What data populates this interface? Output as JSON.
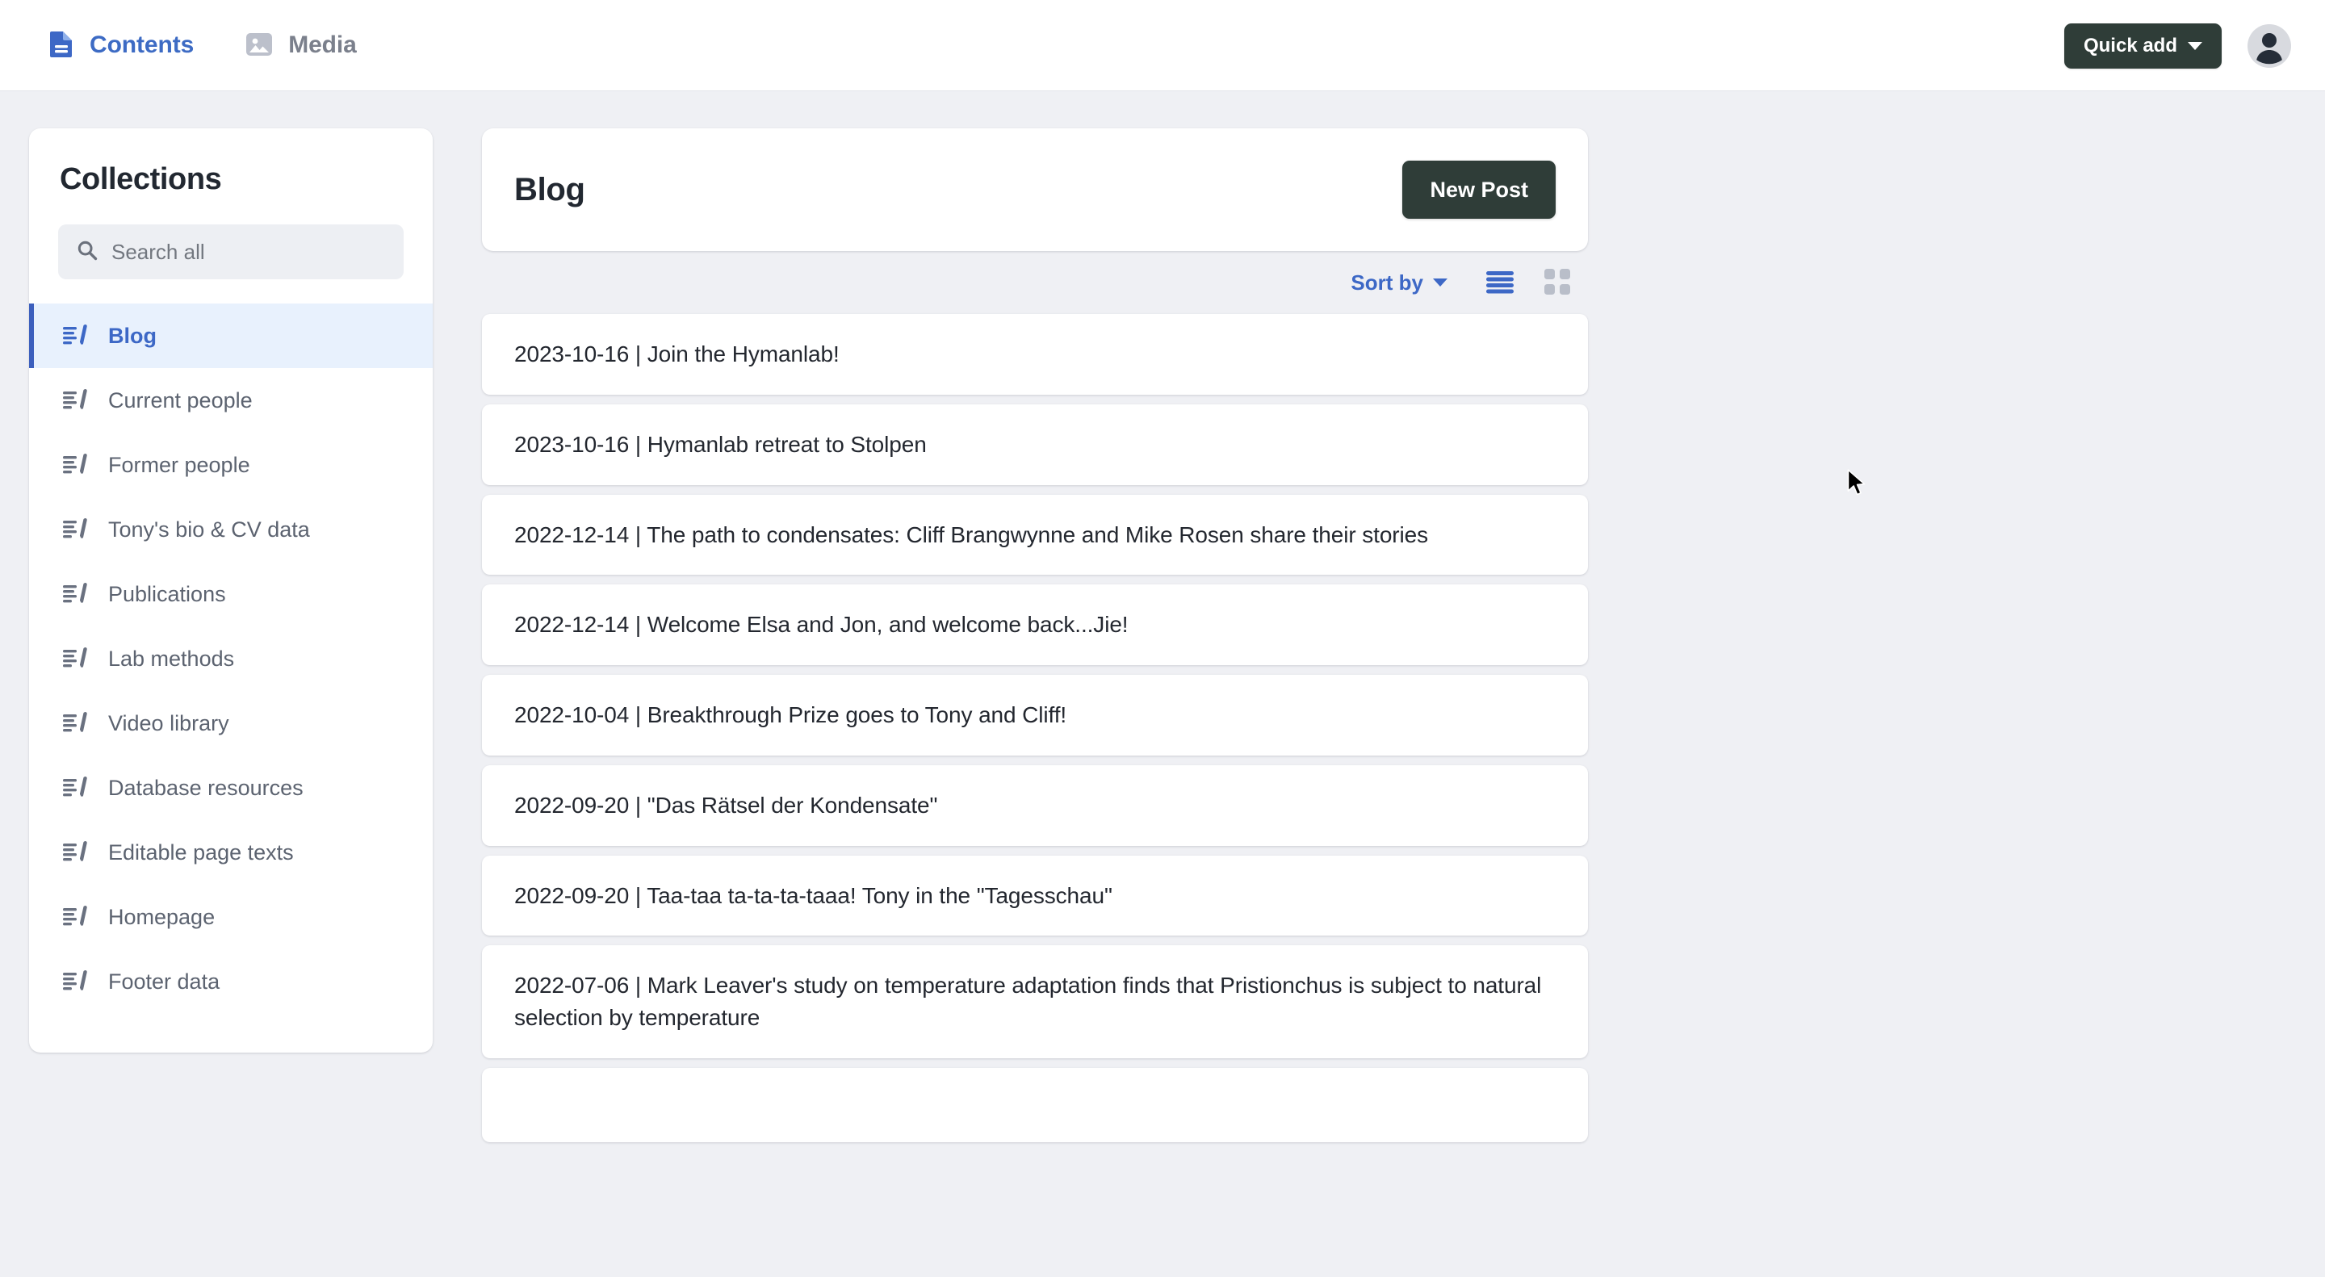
{
  "header": {
    "tabs": [
      {
        "label": "Contents",
        "icon": "document-icon",
        "active": true
      },
      {
        "label": "Media",
        "icon": "image-icon",
        "active": false
      }
    ],
    "quick_add_label": "Quick add",
    "avatar_icon": "user-avatar-icon"
  },
  "sidebar": {
    "title": "Collections",
    "search": {
      "value": "",
      "placeholder": "Search all",
      "icon": "search-icon"
    },
    "items": [
      {
        "label": "Blog",
        "icon": "post-edit-icon",
        "selected": true
      },
      {
        "label": "Current people",
        "icon": "post-edit-icon",
        "selected": false
      },
      {
        "label": "Former people",
        "icon": "post-edit-icon",
        "selected": false
      },
      {
        "label": "Tony's bio & CV data",
        "icon": "post-edit-icon",
        "selected": false
      },
      {
        "label": "Publications",
        "icon": "post-edit-icon",
        "selected": false
      },
      {
        "label": "Lab methods",
        "icon": "post-edit-icon",
        "selected": false
      },
      {
        "label": "Video library",
        "icon": "post-edit-icon",
        "selected": false
      },
      {
        "label": "Database resources",
        "icon": "post-edit-icon",
        "selected": false
      },
      {
        "label": "Editable page texts",
        "icon": "post-edit-icon",
        "selected": false
      },
      {
        "label": "Homepage",
        "icon": "post-edit-icon",
        "selected": false
      },
      {
        "label": "Footer data",
        "icon": "post-edit-icon",
        "selected": false
      }
    ]
  },
  "main": {
    "title": "Blog",
    "new_post_label": "New Post",
    "toolbar": {
      "sort_by_label": "Sort by",
      "list_view_icon": "list-view-icon",
      "grid_view_icon": "grid-view-icon",
      "active_view": "list"
    },
    "posts": [
      {
        "title": "2023-10-16 | Join the Hymanlab!"
      },
      {
        "title": "2023-10-16 | Hymanlab retreat to Stolpen"
      },
      {
        "title": "2022-12-14 | The path to condensates: Cliff Brangwynne and Mike Rosen share their stories"
      },
      {
        "title": "2022-12-14 | Welcome Elsa and Jon, and welcome back...Jie!"
      },
      {
        "title": "2022-10-04 | Breakthrough Prize goes to Tony and Cliff!"
      },
      {
        "title": "2022-09-20 | \"Das Rätsel der Kondensate\""
      },
      {
        "title": "2022-09-20 | Taa-taa ta-ta-ta-taaa! Tony in the \"Tagesschau\""
      },
      {
        "title": "2022-07-06 | Mark Leaver's study on temperature adaptation finds that Pristionchus is subject to natural selection by temperature"
      },
      {
        "title": ""
      }
    ]
  },
  "colors": {
    "page_background": "#eff0f4",
    "accent_blue": "#3d68c6",
    "dark_button": "#2f3d38",
    "selected_row": "#e8f1fd",
    "muted_text": "#5c6370"
  }
}
